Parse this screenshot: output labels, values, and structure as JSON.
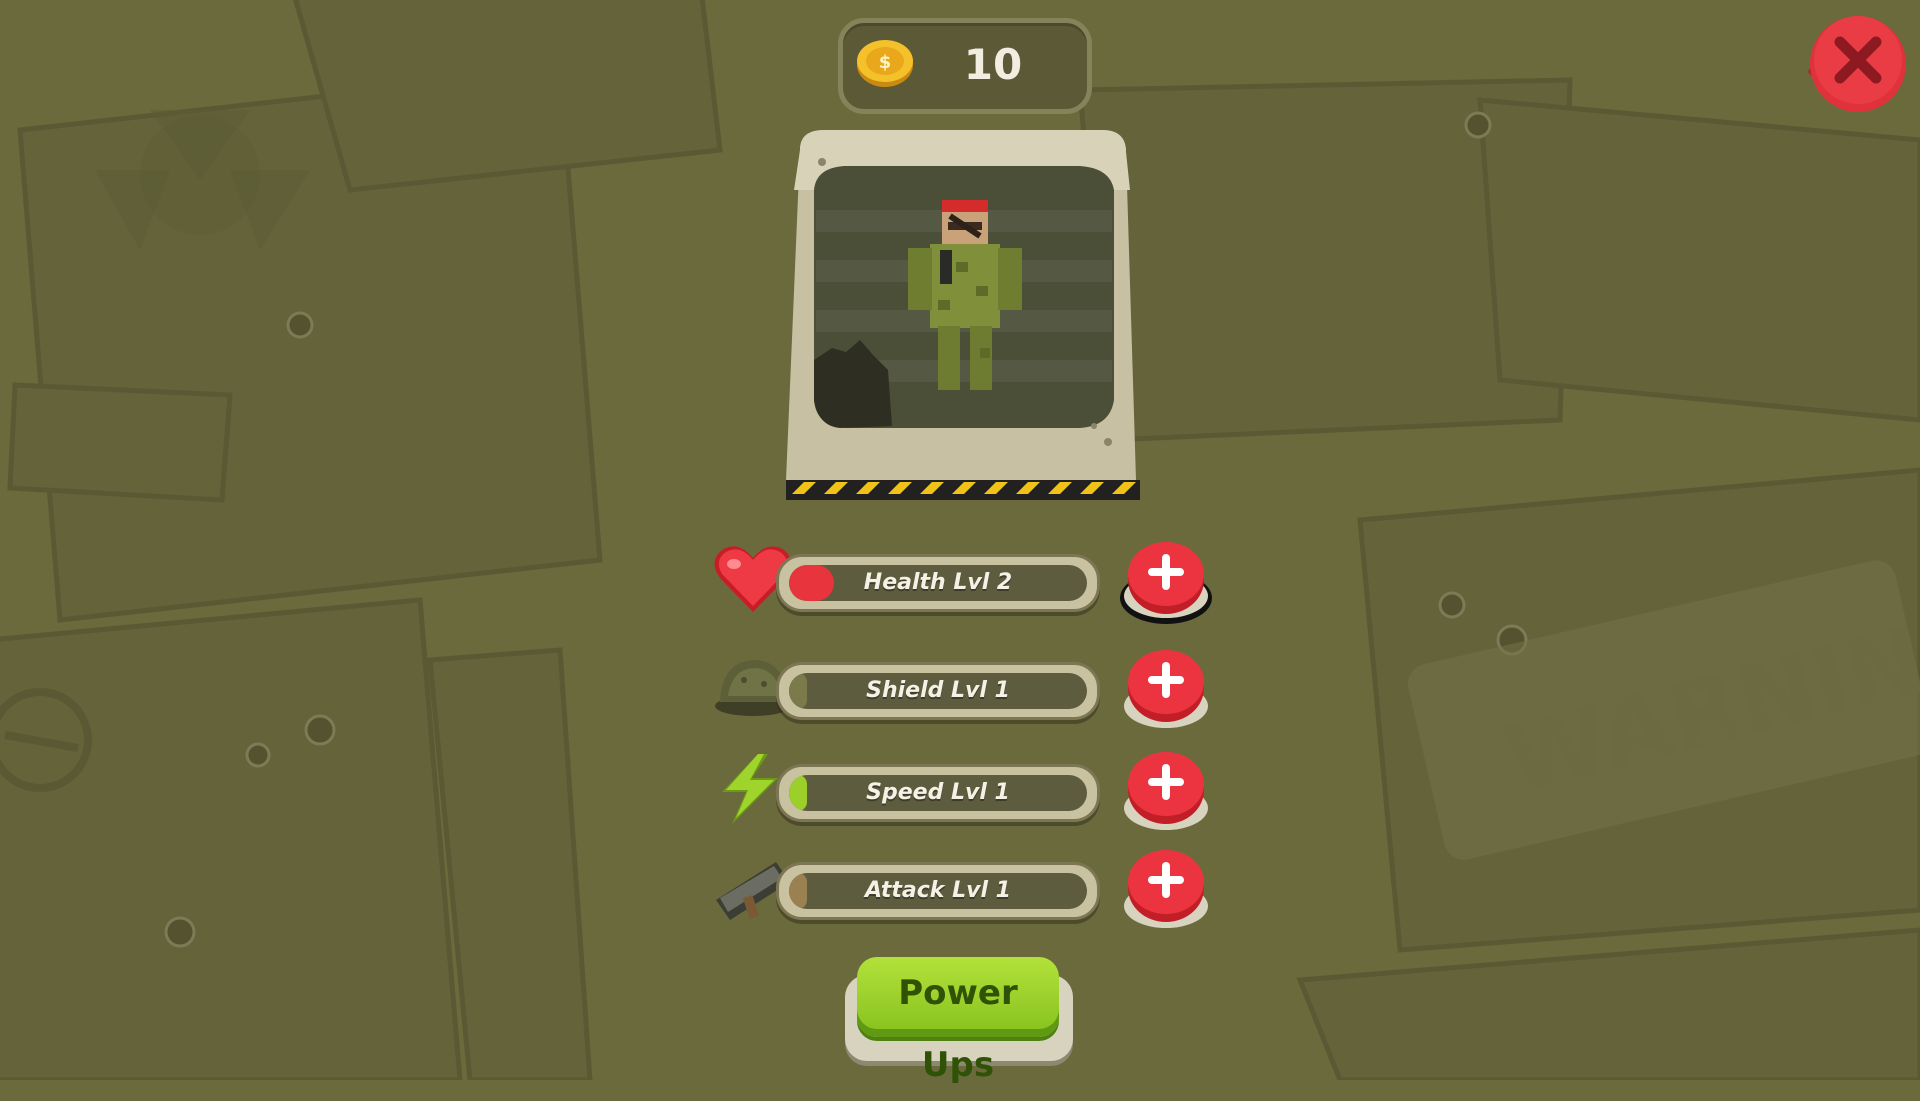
{
  "coins": {
    "value": "10",
    "icon": "gold-coin-icon"
  },
  "close": {
    "icon": "close-icon"
  },
  "character": {
    "name_icon": "soldier-character"
  },
  "stats": [
    {
      "label": "Health Lvl 2",
      "icon": "heart-icon",
      "level_fill": 0.15,
      "fill_color": "#e8343c"
    },
    {
      "label": "Shield Lvl 1",
      "icon": "helmet-icon",
      "level_fill": 0.06,
      "fill_color": "#7a7a4a"
    },
    {
      "label": "Speed Lvl 1",
      "icon": "lightning-icon",
      "level_fill": 0.06,
      "fill_color": "#9ccf2a"
    },
    {
      "label": "Attack Lvl 1",
      "icon": "rocket-launcher-icon",
      "level_fill": 0.06,
      "fill_color": "#9b8152"
    }
  ],
  "power_ups": {
    "label": "Power Ups"
  },
  "background": {
    "watermark_text": "WARNING"
  },
  "colors": {
    "background": "#6b6a3c",
    "plus_button": "#e52a35",
    "power_ups": "#9fd42c",
    "coin": "#f5c12b"
  }
}
